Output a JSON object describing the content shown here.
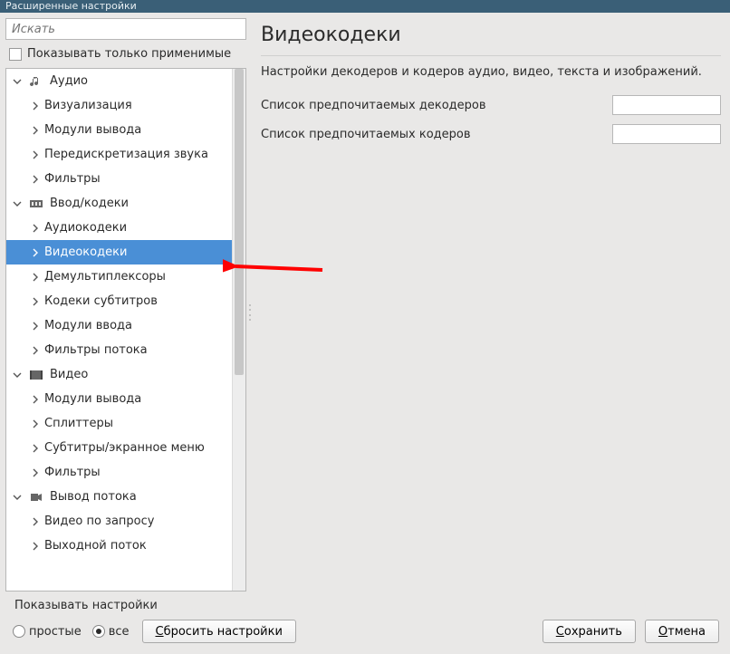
{
  "window": {
    "title": "Расширенные настройки"
  },
  "sidebar": {
    "search_placeholder": "Искать",
    "apply_label": "Показывать только применимые",
    "tree": [
      {
        "kind": "cat",
        "expanded": true,
        "icon": "audio",
        "label": "Аудио"
      },
      {
        "kind": "leaf",
        "label": "Визуализация"
      },
      {
        "kind": "leaf",
        "label": "Модули вывода"
      },
      {
        "kind": "leaf",
        "label": "Передискретизация звука"
      },
      {
        "kind": "leaf",
        "label": "Фильтры"
      },
      {
        "kind": "cat",
        "expanded": true,
        "icon": "codec",
        "label": "Ввод/кодеки"
      },
      {
        "kind": "leaf",
        "label": "Аудиокодеки"
      },
      {
        "kind": "leaf",
        "selected": true,
        "label": "Видеокодеки"
      },
      {
        "kind": "leaf",
        "label": "Демультиплексоры"
      },
      {
        "kind": "leaf",
        "label": "Кодеки субтитров"
      },
      {
        "kind": "leaf",
        "label": "Модули ввода"
      },
      {
        "kind": "leaf",
        "label": "Фильтры потока"
      },
      {
        "kind": "cat",
        "expanded": true,
        "icon": "video",
        "label": "Видео"
      },
      {
        "kind": "leaf",
        "label": "Модули вывода"
      },
      {
        "kind": "leaf",
        "label": "Сплиттеры"
      },
      {
        "kind": "leaf",
        "label": "Субтитры/экранное меню"
      },
      {
        "kind": "leaf",
        "label": "Фильтры"
      },
      {
        "kind": "cat",
        "expanded": true,
        "icon": "stream",
        "label": "Вывод потока"
      },
      {
        "kind": "leaf",
        "label": "Видео по запросу"
      },
      {
        "kind": "leaf",
        "label": "Выходной поток"
      }
    ]
  },
  "content": {
    "title": "Видеокодеки",
    "description": "Настройки декодеров и кодеров аудио, видео, текста и изображений.",
    "row1_label": "Список предпочитаемых декодеров",
    "row2_label": "Список предпочитаемых кодеров"
  },
  "footer": {
    "heading": "Показывать настройки",
    "radio_simple": "простые",
    "radio_all": "все",
    "reset_prefix": "С",
    "reset_rest": "бросить настройки",
    "save_prefix": "С",
    "save_rest": "охранить",
    "cancel_prefix": "О",
    "cancel_rest": "тмена"
  }
}
